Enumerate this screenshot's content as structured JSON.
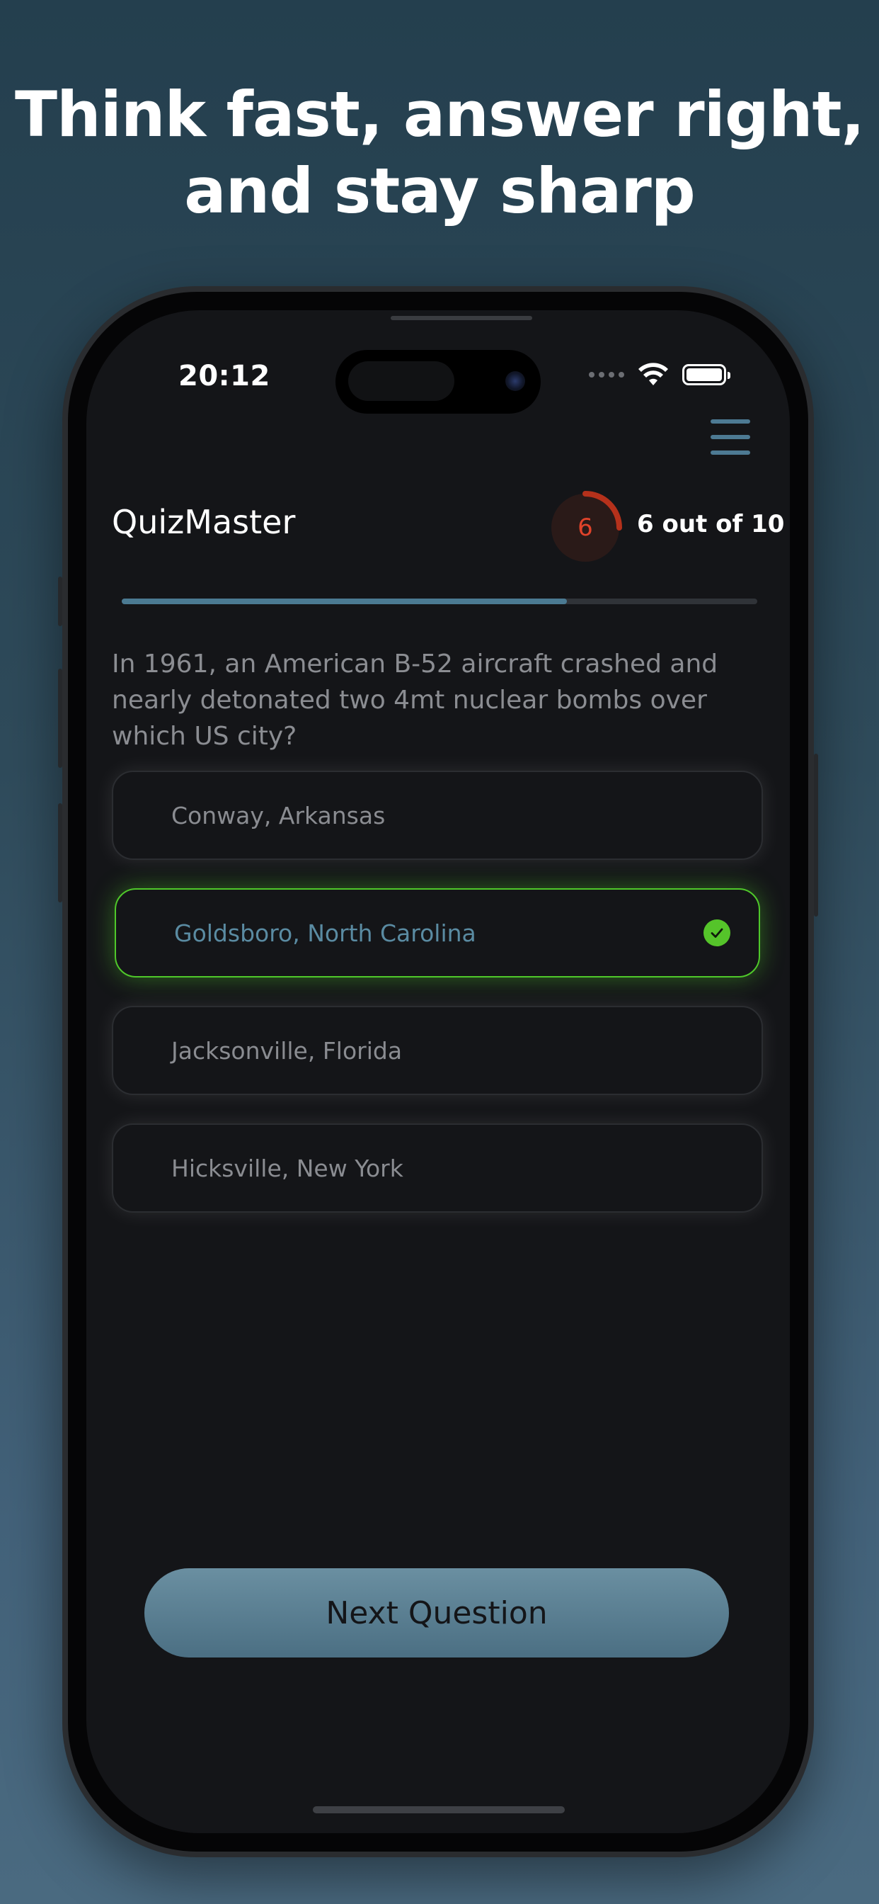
{
  "marketing": {
    "headline_line1": "Think fast, answer right,",
    "headline_line2": "and stay sharp"
  },
  "status_bar": {
    "time": "20:12",
    "icons": [
      "cellular-signal-icon",
      "wifi-icon",
      "battery-icon"
    ]
  },
  "header": {
    "menu_icon": "hamburger-menu-icon",
    "app_title": "QuizMaster",
    "timer_value": "6",
    "timer_color": "#e0432a",
    "score_text": "6 out of 10"
  },
  "progress": {
    "fraction": 0.7,
    "color": "#4b7a92"
  },
  "question": {
    "text": "In 1961, an American B-52 aircraft crashed and nearly detonated two 4mt nuclear bombs over which US city?"
  },
  "answers": [
    {
      "label": "Conway, Arkansas",
      "state": "default"
    },
    {
      "label": "Goldsboro, North Carolina",
      "state": "correct"
    },
    {
      "label": "Jacksonville, Florida",
      "state": "default"
    },
    {
      "label": "Hicksville, New York",
      "state": "default"
    }
  ],
  "colors": {
    "correct": "#4fc82a",
    "accent": "#5a8ba2"
  },
  "next_button": {
    "label": "Next Question"
  }
}
